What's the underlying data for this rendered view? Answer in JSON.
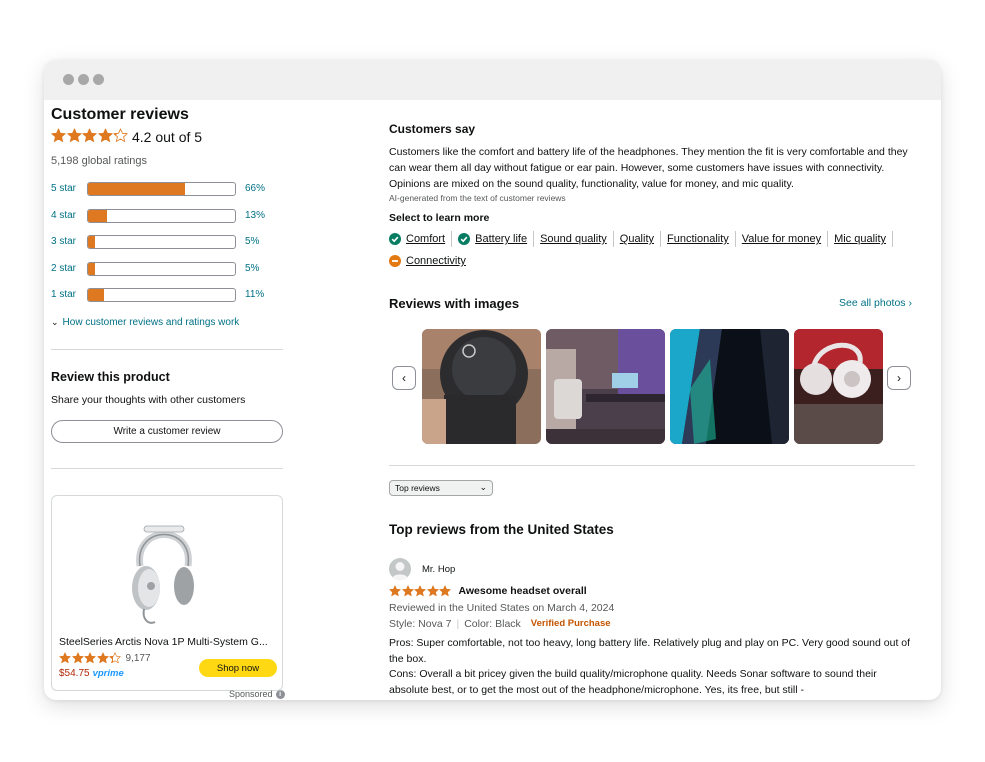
{
  "customer_reviews": {
    "title": "Customer reviews",
    "rating_text": "4.2 out of 5",
    "rating_value": 4.2,
    "global_ratings": "5,198 global ratings",
    "histogram": [
      {
        "label": "5 star",
        "pct": "66%",
        "value": 66
      },
      {
        "label": "4 star",
        "pct": "13%",
        "value": 13
      },
      {
        "label": "3 star",
        "pct": "5%",
        "value": 5
      },
      {
        "label": "2 star",
        "pct": "5%",
        "value": 5
      },
      {
        "label": "1 star",
        "pct": "11%",
        "value": 11
      }
    ],
    "how_link": "How customer reviews and ratings work"
  },
  "review_product": {
    "title": "Review this product",
    "subtitle": "Share your thoughts with other customers",
    "button": "Write a customer review"
  },
  "ad": {
    "title": "SteelSeries Arctis Nova 1P Multi-System G...",
    "rating_value": 4.3,
    "rating_count": "9,177",
    "price": "$54.75",
    "prime": "vprime",
    "button": "Shop now",
    "sponsored": "Sponsored"
  },
  "customers_say": {
    "title": "Customers say",
    "text": "Customers like the comfort and battery life of the headphones. They mention the fit is very comfortable and they can wear them all day without fatigue or ear pain. However, some customers have issues with connectivity. Opinions are mixed on the sound quality, functionality, value for money, and mic quality.",
    "ai_note": "AI-generated from the text of customer reviews",
    "select_title": "Select to learn more",
    "aspects": [
      {
        "label": "Comfort",
        "icon": "positive"
      },
      {
        "label": "Battery life",
        "icon": "positive"
      },
      {
        "label": "Sound quality",
        "icon": "none"
      },
      {
        "label": "Quality",
        "icon": "none"
      },
      {
        "label": "Functionality",
        "icon": "none"
      },
      {
        "label": "Value for money",
        "icon": "none"
      },
      {
        "label": "Mic quality",
        "icon": "none"
      },
      {
        "label": "Connectivity",
        "icon": "negative"
      }
    ]
  },
  "reviews_with_images": {
    "title": "Reviews with images",
    "see_all": "See all photos ›"
  },
  "sort": {
    "selected": "Top reviews"
  },
  "top_reviews": {
    "title": "Top reviews from the United States",
    "review": {
      "reviewer": "Mr. Hop",
      "rating_value": 5,
      "headline": "Awesome headset overall",
      "meta": "Reviewed in the United States on March 4, 2024",
      "style": "Style: Nova 7",
      "color": "Color: Black",
      "verified": "Verified Purchase",
      "body1": "Pros: Super comfortable, not too heavy, long battery life. Relatively plug and play on PC. Very good sound out of the box.",
      "body2": "Cons: Overall a bit pricey given the build quality/microphone quality. Needs Sonar software to sound their absolute best, or to get the most out of the headphone/microphone. Yes, its free, but still -"
    }
  },
  "colors": {
    "star": "#de7921",
    "link": "#007185",
    "positive": "#067d62",
    "negative": "#e47911",
    "button_yellow": "#ffd814",
    "price": "#b12704"
  }
}
